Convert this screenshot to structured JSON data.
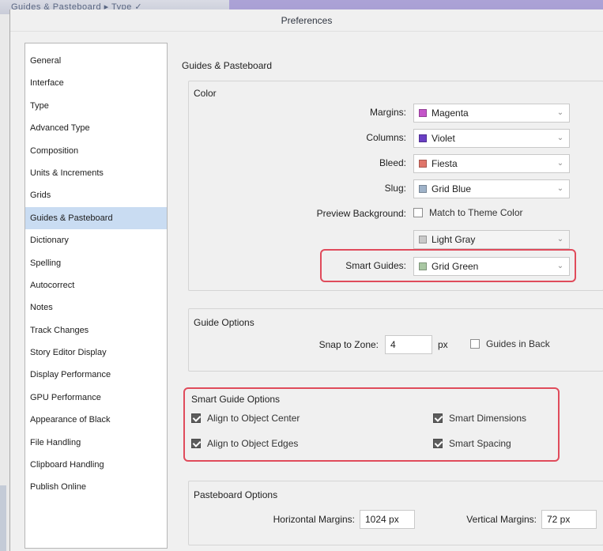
{
  "topstrip": {
    "text": "Guides & Pasteboard ▸ Type ✓"
  },
  "dialog": {
    "title": "Preferences"
  },
  "sidebar": {
    "items": [
      {
        "label": "General"
      },
      {
        "label": "Interface"
      },
      {
        "label": "Type"
      },
      {
        "label": "Advanced Type"
      },
      {
        "label": "Composition"
      },
      {
        "label": "Units & Increments"
      },
      {
        "label": "Grids"
      },
      {
        "label": "Guides & Pasteboard",
        "selected": true
      },
      {
        "label": "Dictionary"
      },
      {
        "label": "Spelling"
      },
      {
        "label": "Autocorrect"
      },
      {
        "label": "Notes"
      },
      {
        "label": "Track Changes"
      },
      {
        "label": "Story Editor Display"
      },
      {
        "label": "Display Performance"
      },
      {
        "label": "GPU Performance"
      },
      {
        "label": "Appearance of Black"
      },
      {
        "label": "File Handling"
      },
      {
        "label": "Clipboard Handling"
      },
      {
        "label": "Publish Online"
      }
    ]
  },
  "main": {
    "section_title": "Guides & Pasteboard",
    "color_panel": {
      "title": "Color",
      "margins": {
        "label": "Margins:",
        "value": "Magenta",
        "swatch": "#c455c9"
      },
      "columns": {
        "label": "Columns:",
        "value": "Violet",
        "swatch": "#6a3fc4"
      },
      "bleed": {
        "label": "Bleed:",
        "value": "Fiesta",
        "swatch": "#e0756a"
      },
      "slug": {
        "label": "Slug:",
        "value": "Grid Blue",
        "swatch": "#9fb3c9"
      },
      "preview_background": {
        "label": "Preview Background:",
        "checkbox_label": "Match to Theme Color",
        "checked": false
      },
      "preview_color": {
        "value": "Light Gray",
        "swatch": "#c9c9c9"
      },
      "smart_guides": {
        "label": "Smart Guides:",
        "value": "Grid Green",
        "swatch": "#a9c7a3"
      }
    },
    "guide_options": {
      "title": "Guide Options",
      "snap_label": "Snap to Zone:",
      "snap_value": "4",
      "snap_unit": "px",
      "guides_in_back": "Guides in Back",
      "guides_in_back_checked": false
    },
    "smart_guide_options": {
      "title": "Smart Guide Options",
      "align_center": "Align to Object Center",
      "align_edges": "Align to Object Edges",
      "smart_dimensions": "Smart Dimensions",
      "smart_spacing": "Smart Spacing"
    },
    "pasteboard_options": {
      "title": "Pasteboard Options",
      "horizontal_label": "Horizontal Margins:",
      "horizontal_value": "1024 px",
      "vertical_label": "Vertical Margins:",
      "vertical_value": "72 px"
    }
  },
  "colors": {
    "highlight": "#e04b5b",
    "selection": "#c9dcf2"
  }
}
